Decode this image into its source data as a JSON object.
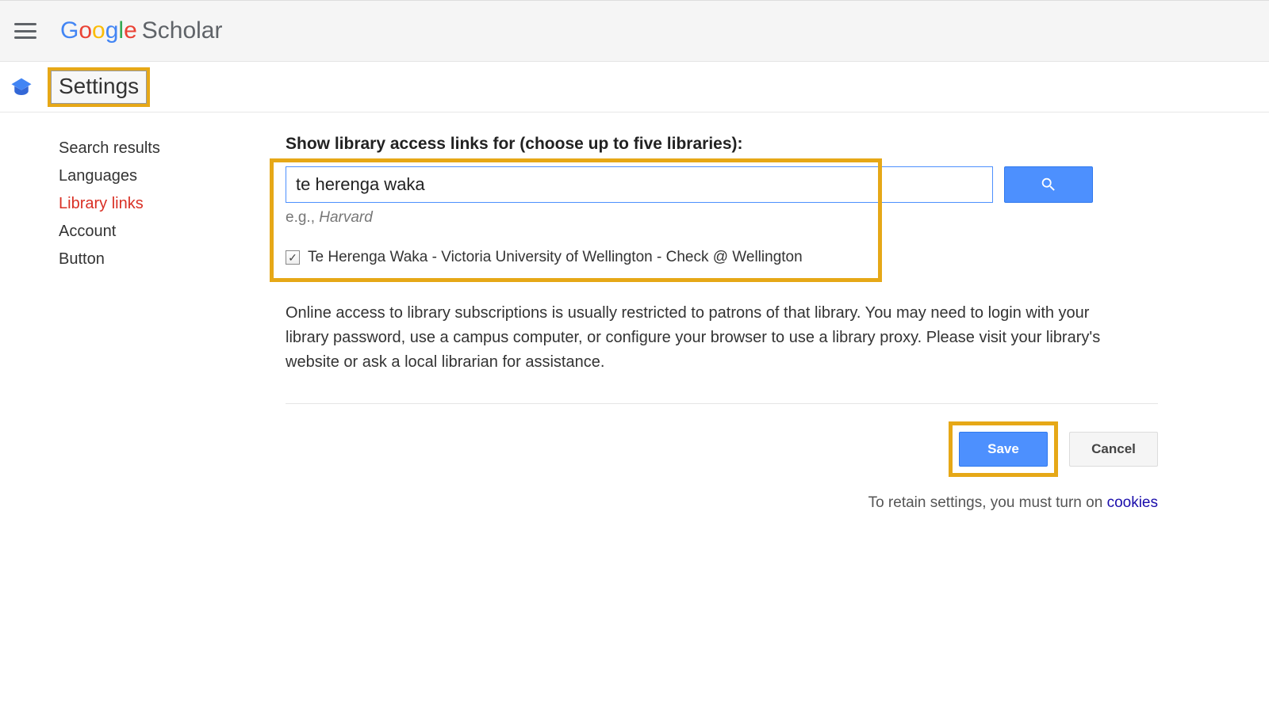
{
  "header": {
    "logo_google": "Google",
    "logo_scholar": "Scholar"
  },
  "subheader": {
    "title": "Settings"
  },
  "sidebar": {
    "items": [
      {
        "label": "Search results",
        "id": "search-results",
        "active": false
      },
      {
        "label": "Languages",
        "id": "languages",
        "active": false
      },
      {
        "label": "Library links",
        "id": "library-links",
        "active": true
      },
      {
        "label": "Account",
        "id": "account",
        "active": false
      },
      {
        "label": "Button",
        "id": "button",
        "active": false
      }
    ]
  },
  "main": {
    "heading": "Show library access links for (choose up to five libraries):",
    "search": {
      "value": "te herenga waka",
      "hint_prefix": "e.g., ",
      "hint_example": "Harvard"
    },
    "result": {
      "checked": true,
      "label": "Te Herenga Waka - Victoria University of Wellington - Check @ Wellington"
    },
    "info_text": "Online access to library subscriptions is usually restricted to patrons of that library. You may need to login with your library password, use a campus computer, or configure your browser to use a library proxy. Please visit your library's website or ask a local librarian for assistance.",
    "buttons": {
      "save": "Save",
      "cancel": "Cancel"
    },
    "cookie_note_prefix": "To retain settings, you must turn on ",
    "cookie_note_link": "cookies"
  }
}
